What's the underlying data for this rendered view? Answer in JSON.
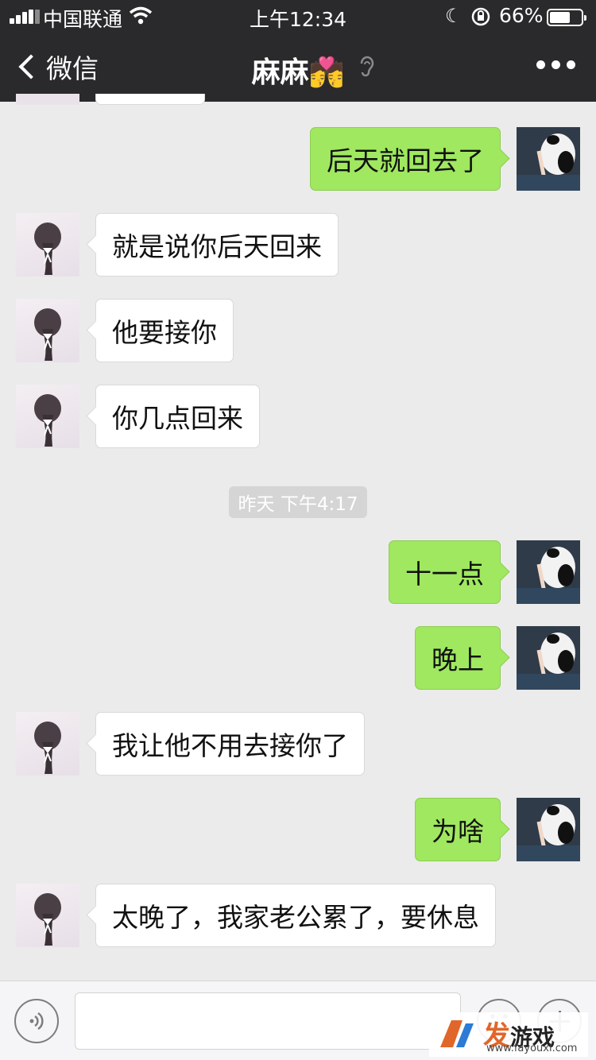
{
  "status_bar": {
    "carrier": "中国联通",
    "time": "上午12:34",
    "battery_percent_text": "66%",
    "battery_level": 0.66
  },
  "nav": {
    "back_label": "微信",
    "title": "麻麻",
    "title_emoji": "💏"
  },
  "messages": [
    {
      "side": "out",
      "text": "后天就回去了"
    },
    {
      "side": "in",
      "text": "就是说你后天回来"
    },
    {
      "side": "in",
      "text": "他要接你"
    },
    {
      "side": "in",
      "text": "你几点回来"
    },
    {
      "side": "out",
      "text": "十一点"
    },
    {
      "side": "out",
      "text": "晚上"
    },
    {
      "side": "in",
      "text": "我让他不用去接你了"
    },
    {
      "side": "out",
      "text": "为啥"
    },
    {
      "side": "in",
      "text": "太晚了，我家老公累了，要休息"
    }
  ],
  "timestamp": "昨天 下午4:17",
  "input_bar": {
    "placeholder": "",
    "value": ""
  },
  "watermark": {
    "brand_accent": "发",
    "brand_rest": "游戏",
    "url": "www.fayouxi.com"
  },
  "colors": {
    "nav_bg": "#2a2a2c",
    "chat_bg": "#ebebeb",
    "outgoing_bubble": "#9fe85f",
    "incoming_bubble": "#ffffff",
    "watermark_accent": "#e0662a"
  },
  "icons": [
    "signal-icon",
    "wifi-icon",
    "moon-icon",
    "rotation-lock-icon",
    "battery-icon",
    "back-chevron-icon",
    "ear-icon",
    "more-icon",
    "voice-icon",
    "emoji-icon",
    "plus-icon"
  ]
}
